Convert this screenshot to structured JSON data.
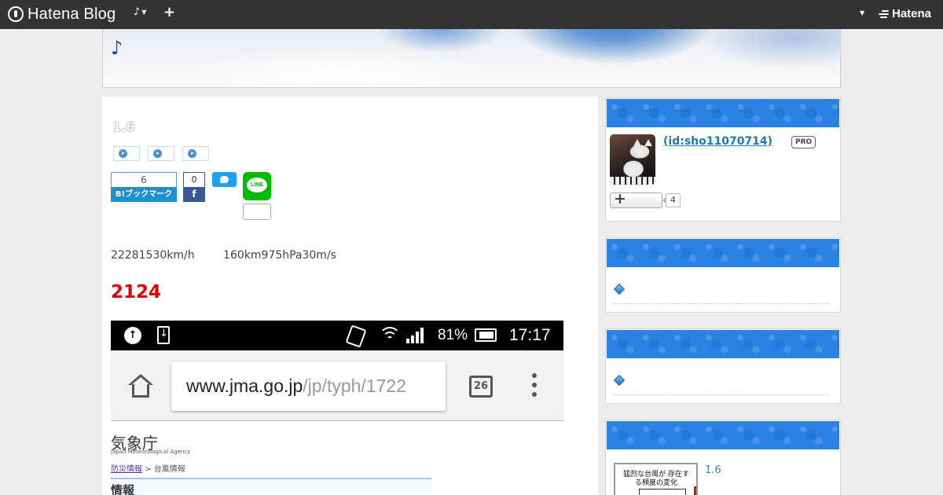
{
  "topbar": {
    "brand": "Hatena Blog",
    "menu_label": "♪",
    "plus": "+",
    "hatena_logo": "Hatena"
  },
  "blog": {
    "title": "♪"
  },
  "entry": {
    "title": "1.6",
    "categories": [
      "",
      "",
      ""
    ],
    "share": {
      "hatebu_count": "6",
      "hatebu_label": "B!ブックマーク",
      "facebook_count": "0",
      "facebook_label": "f",
      "line_label": "LINE"
    },
    "body_text": "22281530km/h 160km975hPa30m/s",
    "highlight": "2124",
    "screenshot": {
      "battery": "81%",
      "time": "17:17",
      "url_host": "www.jma.go.jp",
      "url_path": "/jp/typh/1722",
      "tabs_count": "26",
      "site_logo": "気象庁",
      "site_logo_sub": "Japan Meteorological Agency",
      "breadcrumb_link": "防災情報",
      "breadcrumb_current": "> 台風情報",
      "section_heading": "情報"
    }
  },
  "sidebar": {
    "profile": {
      "id": "(id:sho11070714)",
      "badge": "PRO",
      "follow_count": "4"
    },
    "recent": {
      "thumb_text": "猛烈な台風が 存在する頻度の変化",
      "title": "1.6"
    }
  },
  "colors": {
    "topbar": "#333333",
    "accent_blue": "#2a82e4",
    "highlight_red": "#e00000",
    "link_blue": "#1f78b4"
  },
  "icons": [
    "hatena-logo-icon",
    "plus-icon",
    "play-category-icon",
    "twitter-icon",
    "line-icon",
    "home-icon",
    "tabs-icon",
    "menu-dots-icon",
    "diamond-icon"
  ]
}
